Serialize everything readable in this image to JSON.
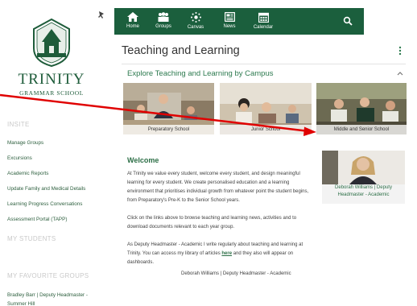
{
  "brand": {
    "name": "TRINITY",
    "subtitle": "GRAMMAR SCHOOL",
    "color": "#1e5c3a"
  },
  "sidebar": {
    "insite_heading": "INSITE",
    "links": [
      "Manage Groups",
      "Excursions",
      "Academic Reports",
      "Update Family and Medical Details",
      "Learning Progress Conversations",
      "Assessment Portal (TAPP)"
    ],
    "students_heading": "MY STUDENTS",
    "favourites_heading": "MY FAVOURITE GROUPS",
    "favourites": [
      "Bradley Barr | Deputy Headmaster - Summer Hill"
    ]
  },
  "nav": {
    "background": "#1b5f3d",
    "items": [
      {
        "label": "Home",
        "icon": "home-icon"
      },
      {
        "label": "Groups",
        "icon": "groups-icon"
      },
      {
        "label": "Canvas",
        "icon": "canvas-icon"
      },
      {
        "label": "News",
        "icon": "news-icon"
      },
      {
        "label": "Calendar",
        "icon": "calendar-icon"
      }
    ],
    "search_icon": "search-icon"
  },
  "page": {
    "title": "Teaching and Learning",
    "section_title": "Explore Teaching and Learning by Campus",
    "campuses": [
      "Preparatory School",
      "Junior School",
      "Middle and Senior School"
    ]
  },
  "welcome": {
    "title": "Welcome",
    "paragraphs": [
      "At Trinity we value every student, welcome every student, and design meaningful learning for every student. We create personalised education and a learning environment that prioritises individual growth from whatever point the student begins, from Preparatory's Pre-K to the Senior School years.",
      "Click on the links above to browse teaching and learning news, activities and to download documents relevant to each year group."
    ],
    "para3_before": "As Deputy Headmaster - Academic I write regularly about teaching and learning at Trinity. You can access my library of articles ",
    "para3_link": "here",
    "para3_after": " and they also will appear on dashboards.",
    "signature": "Deborah Williams | Deputy Headmaster - Academic"
  },
  "deputy": {
    "caption_line1": "Deborah Williams | Deputy",
    "caption_line2": "Headmaster - Academic"
  },
  "colors": {
    "accent_green": "#2d7a4f",
    "arrow_red": "#e00000"
  }
}
